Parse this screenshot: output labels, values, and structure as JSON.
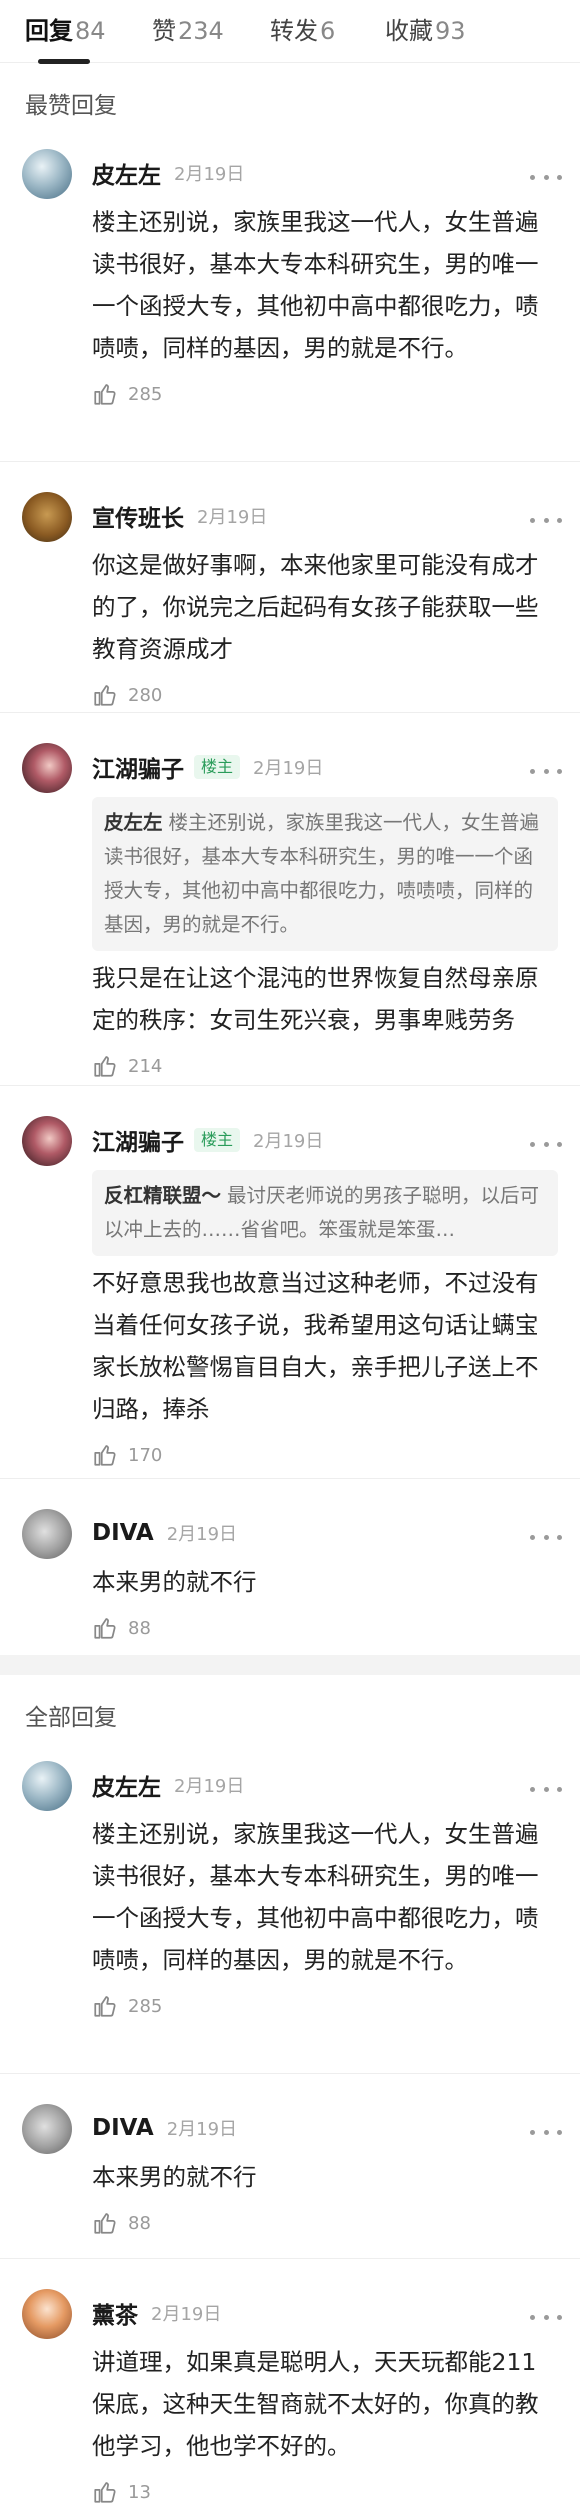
{
  "tabs": [
    {
      "label": "回复",
      "count": "84"
    },
    {
      "label": "赞",
      "count": "234"
    },
    {
      "label": "转发",
      "count": "6"
    },
    {
      "label": "收藏",
      "count": "93"
    }
  ],
  "hot_section_title": "最赞回复",
  "all_section_title": "全部回复",
  "op_badge": "楼主",
  "hot_replies": [
    {
      "name": "皮左左",
      "date": "2月19日",
      "text": "楼主还别说，家族里我这一代人，女生普遍读书很好，基本大专本科研究生，男的唯一一个函授大专，其他初中高中都很吃力，啧啧啧，同样的基因，男的就是不行。",
      "likes": "285"
    },
    {
      "name": "宣传班长",
      "date": "2月19日",
      "text": "你这是做好事啊，本来他家里可能没有成才的了，你说完之后起码有女孩子能获取一些教育资源成才",
      "likes": "280"
    },
    {
      "name": "江湖骗子",
      "date": "2月19日",
      "quote_name": "皮左左",
      "quote_text": "楼主还别说，家族里我这一代人，女生普遍读书很好，基本大专本科研究生，男的唯一一个函授大专，其他初中高中都很吃力，啧啧啧，同样的基因，男的就是不行。",
      "text": "我只是在让这个混沌的世界恢复自然母亲原定的秩序：女司生死兴衰，男事卑贱劳务",
      "likes": "214"
    },
    {
      "name": "江湖骗子",
      "date": "2月19日",
      "quote_name": "反杠精联盟～",
      "quote_text": "最讨厌老师说的男孩子聪明，以后可以冲上去的……省省吧。笨蛋就是笨蛋…",
      "text": "不好意思我也故意当过这种老师，不过没有当着任何女孩子说，我希望用这句话让螨宝家长放松警惕盲目自大，亲手把儿子送上不归路，捧杀",
      "likes": "170"
    },
    {
      "name": "DIVA",
      "date": "2月19日",
      "text": "本来男的就不行",
      "likes": "88"
    }
  ],
  "all_replies": [
    {
      "name": "皮左左",
      "date": "2月19日",
      "text": "楼主还别说，家族里我这一代人，女生普遍读书很好，基本大专本科研究生，男的唯一一个函授大专，其他初中高中都很吃力，啧啧啧，同样的基因，男的就是不行。",
      "likes": "285"
    },
    {
      "name": "DIVA",
      "date": "2月19日",
      "text": "本来男的就不行",
      "likes": "88"
    },
    {
      "name": "薰茶",
      "date": "2月19日",
      "text": "讲道理，如果真是聪明人，天天玩都能211保底，这种天生智商就不太好的，你真的教他学习，他也学不好的。",
      "likes": "13"
    }
  ],
  "colors": {
    "accent_green": "#2a9c5a",
    "text_primary": "#222222",
    "text_secondary": "#9a9a9a"
  },
  "icons": [
    "thumbs-up-icon",
    "more-dots-icon"
  ]
}
